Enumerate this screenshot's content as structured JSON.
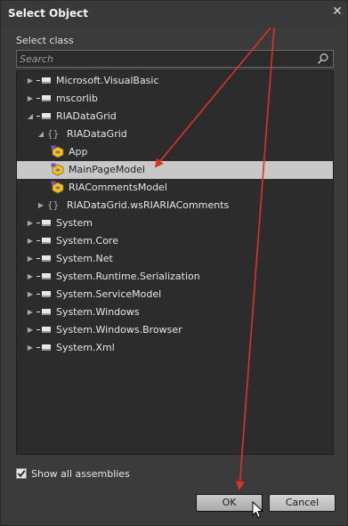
{
  "dialog": {
    "title": "Select Object",
    "close_glyph": "✕"
  },
  "select_class_label": "Select class",
  "search": {
    "placeholder": "Search",
    "value": ""
  },
  "tree_rows": [
    {
      "label": "Microsoft.VisualBasic",
      "kind": "assembly",
      "expander": "▶",
      "level": 0
    },
    {
      "label": "mscorlib",
      "kind": "assembly",
      "expander": "▶",
      "level": 0
    },
    {
      "label": "RIADataGrid",
      "kind": "assembly",
      "expander": "◢",
      "level": 0
    },
    {
      "label": "RIADataGrid",
      "kind": "namespace",
      "expander": "◢",
      "level": 1
    },
    {
      "label": "App",
      "kind": "class",
      "expander": "",
      "level": 2
    },
    {
      "label": "MainPageModel",
      "kind": "class",
      "expander": "",
      "level": 2,
      "selected": true
    },
    {
      "label": "RIACommentsModel",
      "kind": "class",
      "expander": "",
      "level": 2
    },
    {
      "label": "RIADataGrid.wsRIARIAComments",
      "kind": "namespace",
      "expander": "▶",
      "level": 1
    },
    {
      "label": "System",
      "kind": "assembly",
      "expander": "▶",
      "level": 0
    },
    {
      "label": "System.Core",
      "kind": "assembly",
      "expander": "▶",
      "level": 0
    },
    {
      "label": "System.Net",
      "kind": "assembly",
      "expander": "▶",
      "level": 0
    },
    {
      "label": "System.Runtime.Serialization",
      "kind": "assembly",
      "expander": "▶",
      "level": 0
    },
    {
      "label": "System.ServiceModel",
      "kind": "assembly",
      "expander": "▶",
      "level": 0
    },
    {
      "label": "System.Windows",
      "kind": "assembly",
      "expander": "▶",
      "level": 0
    },
    {
      "label": "System.Windows.Browser",
      "kind": "assembly",
      "expander": "▶",
      "level": 0
    },
    {
      "label": "System.Xml",
      "kind": "assembly",
      "expander": "▶",
      "level": 0
    }
  ],
  "show_all_assemblies": {
    "label": "Show all assemblies",
    "checked": true
  },
  "buttons": {
    "ok": "OK",
    "cancel": "Cancel"
  },
  "annotation_color": "#e0302c",
  "icons": {
    "search": "search-icon",
    "close": "close-icon",
    "assembly": "assembly-icon",
    "namespace": "namespace-icon",
    "class": "class-icon",
    "checkmark": "checkmark-icon",
    "cursor": "mouse-cursor-icon"
  }
}
